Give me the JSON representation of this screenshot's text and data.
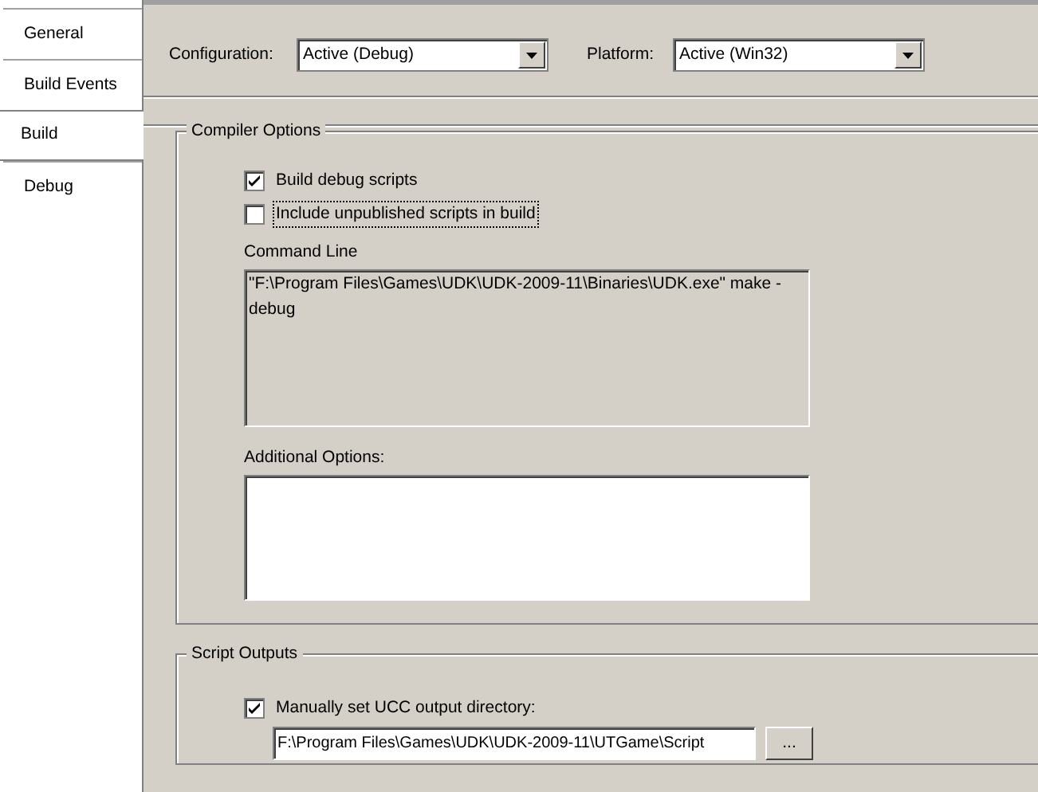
{
  "tabs": [
    {
      "label": "General",
      "selected": false
    },
    {
      "label": "Build Events",
      "selected": false
    },
    {
      "label": "Build",
      "selected": true
    },
    {
      "label": "Debug",
      "selected": false
    }
  ],
  "configuration": {
    "label": "Configuration:",
    "value": "Active (Debug)"
  },
  "platform": {
    "label": "Platform:",
    "value": "Active (Win32)"
  },
  "compiler_options": {
    "title": "Compiler Options",
    "checkboxes": [
      {
        "label": "Build debug scripts",
        "checked": true,
        "focused": false
      },
      {
        "label": "Include unpublished scripts in build",
        "checked": false,
        "focused": true
      }
    ],
    "command_line": {
      "label": "Command Line",
      "value": "\"F:\\Program Files\\Games\\UDK\\UDK-2009-11\\Binaries\\UDK.exe\" make -debug"
    },
    "additional_options": {
      "label": "Additional Options:"
    }
  },
  "script_outputs": {
    "title": "Script Outputs",
    "checkbox": {
      "label": "Manually set UCC output directory:",
      "checked": true
    },
    "output_directory": {
      "value": "F:\\Program Files\\Games\\UDK\\UDK-2009-11\\UTGame\\Script"
    },
    "browse_button": "..."
  }
}
